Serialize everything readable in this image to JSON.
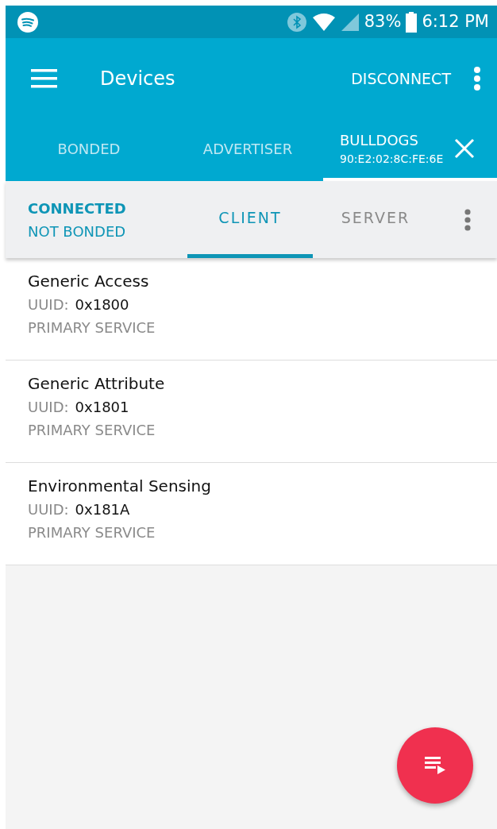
{
  "status_bar": {
    "battery": "83%",
    "time": "6:12 PM"
  },
  "toolbar": {
    "title": "Devices",
    "action": "DISCONNECT"
  },
  "device_tabs": [
    {
      "label": "BONDED",
      "selected": false
    },
    {
      "label": "ADVERTISER",
      "selected": false
    },
    {
      "label": "BULLDOGS",
      "address": "90:E2:02:8C:FE:6E",
      "selected": true
    }
  ],
  "connection": {
    "status": "CONNECTED",
    "bond": "NOT BONDED"
  },
  "role_tabs": [
    {
      "label": "CLIENT",
      "selected": true
    },
    {
      "label": "SERVER",
      "selected": false
    }
  ],
  "services": [
    {
      "name": "Generic Access",
      "uuid_label": "UUID:",
      "uuid": "0x1800",
      "type": "PRIMARY SERVICE"
    },
    {
      "name": "Generic Attribute",
      "uuid_label": "UUID:",
      "uuid": "0x1801",
      "type": "PRIMARY SERVICE"
    },
    {
      "name": "Environmental Sensing",
      "uuid_label": "UUID:",
      "uuid": "0x181A",
      "type": "PRIMARY SERVICE"
    }
  ]
}
